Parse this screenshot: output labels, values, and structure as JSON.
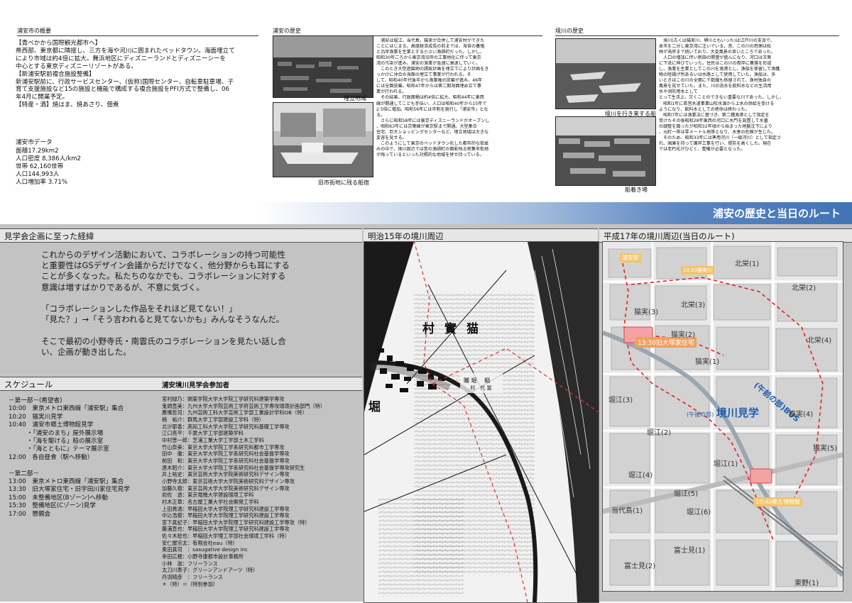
{
  "top": {
    "overview": {
      "heading": "浦安市の概要",
      "body": "【青べかから国際観光都市へ】\n県西部、東京都に隣接し、三方を海や河川に囲まれたベッドタウン。海面埋立て\nにより市域は約4倍に拡大。舞浜地区にディズニーランドとディズニーシーを\n中心とする東京ディズニーリゾートがある。\n【新浦安駅前複合施設整備】\n新浦安駅前に、行政サービスセンター、(仮称)国際センター、自転車駐車場、子\n育て支援施設など15の施設と機能で構成する複合施設をPFI方式で整備し、06\n年4月に開業予定。\n【特産・酒】焼はま、焼あさり、佃煮",
      "data_title": "浦安市データ",
      "data_lines": "面積17.29km2\n人口密度 8,386人/km2\n世帯 62,160世帯\n人口144,993人\n人口増加率 3.71%"
    },
    "history": {
      "heading": "浦安の歴史",
      "body": "　浦安は堀江，当代島，猫実が合併して浦安村ができた\nことにはじまる。高度経済成長の前までは、海苔の養殖\nと沿岸漁業を生業とする小さい漁師町だった。しかし、\n昭和30年ごろから東京湾沿岸の工業地化に伴って東京\n湾の汚染が進み、浦安の漁業が急速に衰退していく。\n　このとき大型遊園地の誘致計画を埋立てにより計画をき\nっかけに沖合の海面の埋立て事業が行われる。そ\nして、昭和40年代後半から漁業権の放棄が進み、46年\nには全面放棄。昭和47年からは第二期海面埋め立て事\n業が行われる。\n　その結果、行政面積は約4倍に拡大。昭和44年に東西\n線が開通してこども手伝い、人口は昭和40年から15年で\n2.5倍に増加。昭和56年には市制を施行し「浦安市」とな\nる。\n　さらに昭和58年には東京ディズニーランドがオープンし\n、昭和63年には京葉線が東京駅まで開通。大型集合\n住宅、巨大ショッピングセンターなど、埋立地域は大きな\n変容を見せる。\n　このようにして東京のベッドタウン化した都市的な街並\nみの中で、境川周辺では昔の漁師町の面影残る密集市街地\nが残っているといった対照的な地域を併せ持っている。",
      "caption1": "埋立地域",
      "caption2": "旧市街地に残る船宿"
    },
    "sakaigawa": {
      "heading": "境川の歴史",
      "body": "　境川(古くは猫実川、堺川ともいった)は江戸川の支流で、\n本市を二分し東京湾に注いでいる。昔、この川の両側は松\n林が海岸まで続いており、大変風景の良いところであった。\n　人口の増加に伴い新田の開墾が盛んになり、河口は次第\nに下流に伸びていった。住民はこの川の両岸に集落を形成\nし、漁業を生業としてこの川を漁港とし、漁船を係留して漁獲\n物の陸揚げ所あるいは水路として使用していた。漁船は、多\nいときはこの川の全面に千数艘も係留されて、漁村独自の\n風景を見せていた。また、川の流水を飲料水などの生活用\n水や消防用水として\nとって生活上、欠くことのできない重要な川であった。しかし、\n　昭和1年に県営水道事業山吹水源から上水の供給を受ける\nようになり、飲料水としての使命は終わった。\n　昭和7年には漁業法に基づき、第二種漁港として指定を\n受けたその後昭和28年東西の河口に水門を設置して水量\nの調整を図ったが昭和32年頃から始まった地盤沈下により\n、元町一帯は零メートル地帯となり、水害の危険が生じた。\n　そのため、昭和33年には準用河川（一級河川）として指定さ\nれ、国庫を持って護岸工事を行い、堤防を高くした。現在\nでは老朽化がひどく、整備が必要となった。",
      "caption1": "境川を行き来する船",
      "caption2": "船着き場"
    }
  },
  "banner": {
    "title": "浦安の歴史と当日のルート"
  },
  "bottom": {
    "background": {
      "heading": "見学会企画に至った経緯",
      "body": "これからのデザイン活動において、コラボレーションの持つ可能性\nと重要性はGSデザイン会議からだけでなく、他分野からも耳にする\nことが多くなった。私たちのなかでも、コラボレーションに対する\n意識は増すばかりであるが、不意に気づく。\n\n「コラボレーションした作品をそれほど見てない！」\n「見た？」→「そう言われると見てないかも」みんなそうなんだ。\n\nそこで最初の小野寺氏・南雲氏のコラボレーションを見たい話し合\nい、企画が動き出した。"
    },
    "schedule": {
      "heading": "スケジュール",
      "body": "－第一部－(希望者)\n10:00　東京メトロ東西線「浦安駅」集合\n10:20　猫実川見学\n10:40　浦安市郷土博物館見学\n　　　・「浦安のまち」屋外展示場\n　　　・「海を駆ける」船の展示室\n　　　・「海とともに」テーマ展示室\n12:00　各自昼食（駅へ移動）\n\n－第二部－\n13:00　東京メトロ東西線「浦安駅」集合\n13:30　旧大塚家住宅・旧宇田川家住宅見学\n15:00　未整備地区(Bゾーン)へ移動\n15:30　整備地区(Cゾーン)見学\n17:00　懇親会"
    },
    "participants": {
      "heading": "浦安境川見学会参加者",
      "body": "宮村緑乃：関東学院大学大学院工学研究科建築学専攻\n鬼頭直美：九州大学大学院芸術工学府芸術工学専攻環境計画部門（特）\n鷹嘴哲司：九州芸術工科大学芸術工学部工業設計学科OB（特）\n楠　裕介：群馬大学工学部建設工学科（特）\n北沙耶香：高知工科大学大学院工学研究科基礎工学専攻\n江口亮平：千葉大学工学部建築学科\n中村普一郎：芝浦工業大学工学部土木工学科\n竹山奈美：東京大学大学院工学系研究科都市工学専攻\n田中　徹：東京大学大学院工学系研究科社会基盤学専攻\n前田　和：東京大学大学院工学系研究科社会基盤学専攻\n唐木昭介：東京大学大学院工学系研究科社会基盤学専攻研究生\n井上祐史：東京芸術大学大学院美術研究科デザイン専攻\n小野寺太郎：東京芸術大学大学院美術研究科デザイン専攻\n加藤久樹：東京芸術大学大学院美術研究科デザイン専攻\n岩佐　透：東京電機大学建設環境工学科\n村木正章：名古屋工業大学社会開発工学科\n上田貴通：早稲田大学大学院理工学研究科建設工学専攻\n中込浩樹：早稲田大学大学院理工学研究科建設工学専攻\n宮下真紀子：早稲田大学大学院理工学研究科建設工学専攻（特）\n藤浦直也：早稲田大学大学院理工学研究科建設工学専攻\n佐々木稔也：早稲田大学理工学部社会環境工学科（特）\n安仁屋宗太：有限会社eau（特）\n奥田真司　：sasugative design inc\n幸田広穂：小野寺康都市設計事務所\n小林　滋：フリーランス\n太刀川寿子：グリーンアンドアーツ（特）\n丹羽晴彦　：フリーランス\n＊（特）＝（特別参加）"
    },
    "map1": {
      "heading": "明治15年の境川周辺",
      "labels": [
        "村實猫",
        "堀",
        "當代島"
      ]
    },
    "map2": {
      "heading": "平成17年の境川周辺(当日のルート)",
      "route_main": "境川見学",
      "route_main_tag": "(午後の部)",
      "route_bus": "(午前の部)BUS",
      "route_museum": "10:40郷土博物館",
      "route_station": "浦安駅",
      "route_nekozane": "10:20猫実川",
      "route_house": "13:30旧大塚家住宅",
      "areas": [
        "北栄(1)",
        "北栄(2)",
        "北栄(3)",
        "北栄(4)",
        "猫実(1)",
        "猫実(2)",
        "猫実(3)",
        "猫実(4)",
        "猫実(5)",
        "堀江(1)",
        "堀江(2)",
        "堀江(3)",
        "堀江(4)",
        "堀江(5)",
        "堀江(6)",
        "当代島(1)",
        "富士見(1)",
        "富士見(2)",
        "東野(1)"
      ]
    }
  }
}
